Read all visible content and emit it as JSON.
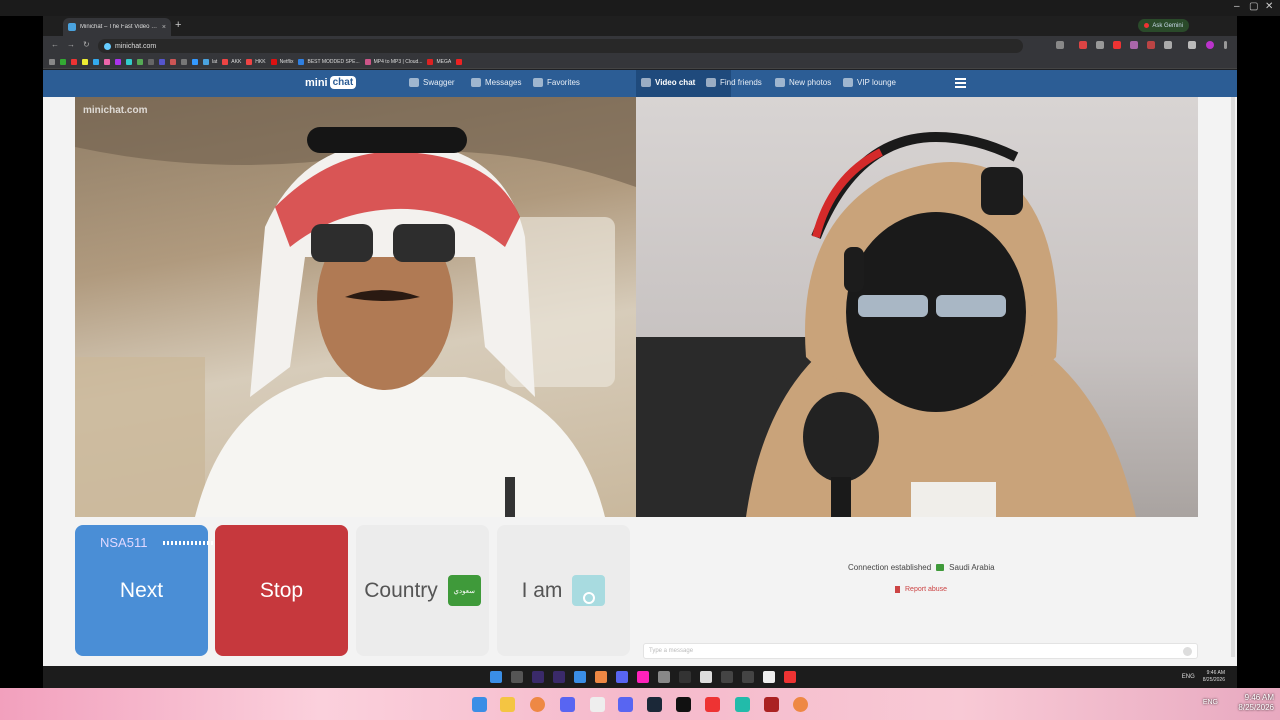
{
  "browser": {
    "tab_title": "Minichat – The Fast Video …",
    "tab_close": "×",
    "new_tab": "+",
    "ask_gemini": "Ask Gemini",
    "url": "minichat.com",
    "window_controls": [
      "–",
      "▢",
      "✕"
    ],
    "nav": [
      "←",
      "→",
      "↻"
    ],
    "bookmarks": [
      {
        "label": "lat",
        "color": "#4aa3df"
      },
      {
        "label": "AKK",
        "color": "#e44"
      },
      {
        "label": "HKK",
        "color": "#e44"
      },
      {
        "label": "Netflix",
        "color": "#d11"
      },
      {
        "label": "BEST MODDED SPE...",
        "color": "#2f7fe0"
      },
      {
        "label": "MP4 to MP3 | Cloud...",
        "color": "#c58"
      },
      {
        "label": "MEGA",
        "color": "#d22"
      }
    ]
  },
  "site": {
    "logo_left": "mini",
    "logo_bubble": "chat",
    "nav": {
      "swagger": "Swagger",
      "messages": "Messages",
      "favorites": "Favorites",
      "video_chat": "Video chat",
      "find_friends": "Find friends",
      "new_photos": "New photos",
      "vip_lounge": "VIP lounge"
    },
    "watermark": "minichat.com"
  },
  "controls": {
    "user_tag": "NSA511",
    "next": "Next",
    "stop": "Stop",
    "country": "Country",
    "flag_text": "سعودي",
    "iam": "I am"
  },
  "status": {
    "connection": "Connection established",
    "country": "Saudi Arabia",
    "report": "Report abuse",
    "message_placeholder": "Type a message"
  },
  "taskbar": {
    "lang": "ENG",
    "time": "9:46 AM",
    "date": "8/25/2026"
  },
  "desktop": {
    "lang": "ENG",
    "time": "9:46 AM",
    "date": "8/25/2026"
  },
  "colors": {
    "nav_bar": "#2c5d95",
    "next_button": "#4a8ed6",
    "stop_button": "#c6383d",
    "flag_green": "#3f9a3a"
  }
}
